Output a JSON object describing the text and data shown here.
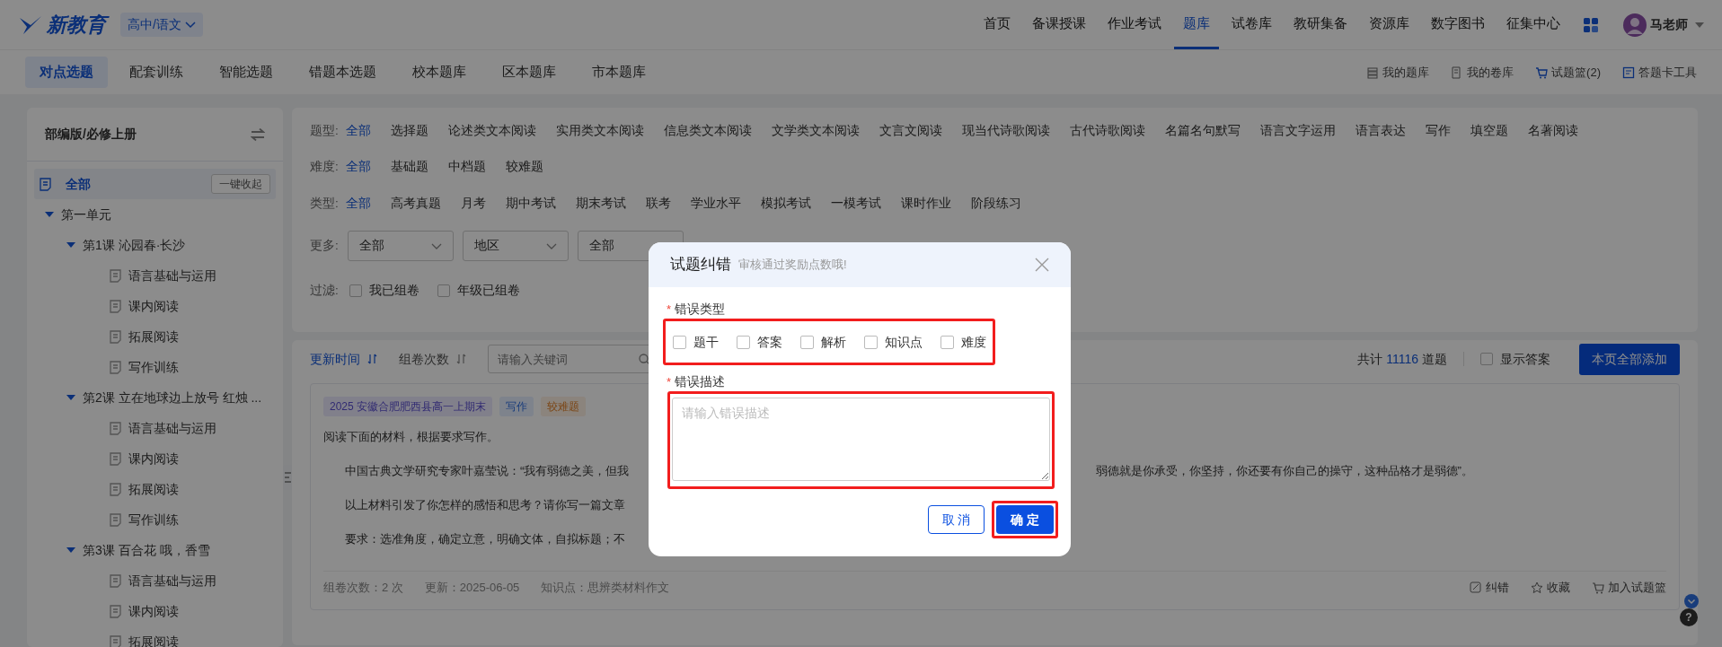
{
  "header": {
    "logo": "新教育",
    "grade": "高中/语文",
    "nav": [
      {
        "label": "首页",
        "selected": false
      },
      {
        "label": "备课授课",
        "selected": false
      },
      {
        "label": "作业考试",
        "selected": false
      },
      {
        "label": "题库",
        "selected": true
      },
      {
        "label": "试卷库",
        "selected": false
      },
      {
        "label": "教研集备",
        "selected": false
      },
      {
        "label": "资源库",
        "selected": false
      },
      {
        "label": "数字图书",
        "selected": false
      },
      {
        "label": "征集中心",
        "selected": false
      }
    ],
    "user": "马老师"
  },
  "subnav": {
    "tabs": [
      {
        "label": "对点选题",
        "selected": true
      },
      {
        "label": "配套训练",
        "selected": false
      },
      {
        "label": "智能选题",
        "selected": false
      },
      {
        "label": "错题本选题",
        "selected": false
      },
      {
        "label": "校本题库",
        "selected": false
      },
      {
        "label": "区本题库",
        "selected": false
      },
      {
        "label": "市本题库",
        "selected": false
      }
    ],
    "tools": [
      {
        "kind": "bank",
        "label": "我的题库"
      },
      {
        "kind": "papers",
        "label": "我的卷库"
      },
      {
        "kind": "cart",
        "label": "试题篮(2)"
      },
      {
        "kind": "card",
        "label": "答题卡工具"
      }
    ]
  },
  "sidebar": {
    "title": "部编版/必修上册",
    "all": {
      "label": "全部",
      "selected": true
    },
    "collapse_button": "一键收起",
    "tree": [
      {
        "label": "第一单元",
        "expanded": true,
        "children": [
          {
            "label": "第1课 沁园春·长沙",
            "expanded": true,
            "children": [
              {
                "label": "语言基础与运用"
              },
              {
                "label": "课内阅读"
              },
              {
                "label": "拓展阅读"
              },
              {
                "label": "写作训练"
              }
            ]
          },
          {
            "label": "第2课 立在地球边上放号 红烛 ...",
            "expanded": true,
            "children": [
              {
                "label": "语言基础与运用"
              },
              {
                "label": "课内阅读"
              },
              {
                "label": "拓展阅读"
              },
              {
                "label": "写作训练"
              }
            ]
          },
          {
            "label": "第3课 百合花 哦，香雪",
            "expanded": true,
            "children": [
              {
                "label": "语言基础与运用"
              },
              {
                "label": "课内阅读"
              },
              {
                "label": "拓展阅读"
              }
            ]
          }
        ]
      }
    ]
  },
  "filters": [
    {
      "label": "题型:",
      "options": [
        {
          "label": "全部",
          "selected": true
        },
        {
          "label": "选择题",
          "selected": false
        },
        {
          "label": "论述类文本阅读",
          "selected": false
        },
        {
          "label": "实用类文本阅读",
          "selected": false
        },
        {
          "label": "信息类文本阅读",
          "selected": false
        },
        {
          "label": "文学类文本阅读",
          "selected": false
        },
        {
          "label": "文言文阅读",
          "selected": false
        },
        {
          "label": "现当代诗歌阅读",
          "selected": false
        },
        {
          "label": "古代诗歌阅读",
          "selected": false
        },
        {
          "label": "名篇名句默写",
          "selected": false
        },
        {
          "label": "语言文字运用",
          "selected": false
        },
        {
          "label": "语言表达",
          "selected": false
        },
        {
          "label": "写作",
          "selected": false
        },
        {
          "label": "填空题",
          "selected": false
        },
        {
          "label": "名著阅读",
          "selected": false
        }
      ]
    },
    {
      "label": "难度:",
      "options": [
        {
          "label": "全部",
          "selected": true
        },
        {
          "label": "基础题",
          "selected": false
        },
        {
          "label": "中档题",
          "selected": false
        },
        {
          "label": "较难题",
          "selected": false
        }
      ]
    },
    {
      "label": "类型:",
      "options": [
        {
          "label": "全部",
          "selected": true
        },
        {
          "label": "高考真题",
          "selected": false
        },
        {
          "label": "月考",
          "selected": false
        },
        {
          "label": "期中考试",
          "selected": false
        },
        {
          "label": "期末考试",
          "selected": false
        },
        {
          "label": "联考",
          "selected": false
        },
        {
          "label": "学业水平",
          "selected": false
        },
        {
          "label": "模拟考试",
          "selected": false
        },
        {
          "label": "一模考试",
          "selected": false
        },
        {
          "label": "课时作业",
          "selected": false
        },
        {
          "label": "阶段练习",
          "selected": false
        }
      ]
    }
  ],
  "more": {
    "label": "更多:",
    "dropdowns": [
      "全部",
      "地区",
      "全部"
    ]
  },
  "filter_checks": {
    "label": "过滤:",
    "options": [
      {
        "label": "我已组卷",
        "checked": false
      },
      {
        "label": "年级已组卷",
        "checked": false
      }
    ]
  },
  "toolbar": {
    "sorts": [
      {
        "label": "更新时间",
        "selected": true
      },
      {
        "label": "组卷次数",
        "selected": false
      }
    ],
    "search_placeholder": "请输入关键词",
    "total_prefix": "共计",
    "total": "11116",
    "total_suffix": "道题",
    "show_answer": {
      "label": "显示答案",
      "checked": false
    },
    "add_all": "本页全部添加"
  },
  "question": {
    "tags": [
      {
        "kind": "source",
        "label": "2025 安徽合肥肥西县高一上期末"
      },
      {
        "kind": "type",
        "label": "写作"
      },
      {
        "kind": "difficulty",
        "label": "较难题"
      }
    ],
    "intro": "阅读下面的材料，根据要求写作。",
    "lines": [
      {
        "left": "中国古典文学研究专家叶嘉莹说：“我有弱德之美，但我",
        "right": "弱德就是你承受，你坚持，你还要有你自己的操守，这种品格才是弱德”。"
      },
      {
        "left": "以上材料引发了你怎样的感悟和思考？请你写一篇文章"
      },
      {
        "left": "要求：选准角度，确定立意，明确文体，自拟标题；不"
      }
    ],
    "meta": [
      "组卷次数：2 次",
      "更新：2025-06-05",
      "知识点：思辨类材料作文"
    ],
    "actions": [
      {
        "kind": "fix",
        "label": "纠错"
      },
      {
        "kind": "star",
        "label": "收藏"
      },
      {
        "kind": "cart",
        "label": "加入试题篮"
      }
    ]
  },
  "help": "?",
  "modal": {
    "title": "试题纠错",
    "subtitle": "审核通过奖励点数哦!",
    "type_field": {
      "mark": "*",
      "label": "错误类型",
      "highlighted": true,
      "options": [
        {
          "label": "题干",
          "checked": false
        },
        {
          "label": "答案",
          "checked": false
        },
        {
          "label": "解析",
          "checked": false
        },
        {
          "label": "知识点",
          "checked": false
        },
        {
          "label": "难度",
          "checked": false
        }
      ]
    },
    "desc_field": {
      "mark": "*",
      "label": "错误描述",
      "highlighted": true,
      "placeholder": "请输入错误描述"
    },
    "cancel": "取 消",
    "confirm": {
      "label": "确 定",
      "highlighted": true
    }
  }
}
